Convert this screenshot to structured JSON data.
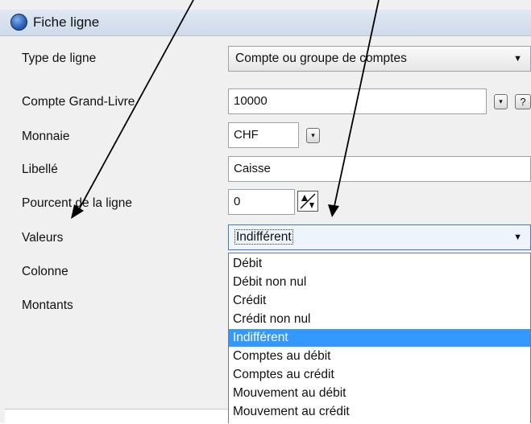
{
  "window": {
    "title": "Fiche ligne",
    "icon": "app-icon"
  },
  "form": {
    "type_ligne": {
      "label": "Type de ligne",
      "value": "Compte ou groupe de comptes"
    },
    "compte": {
      "label": "Compte Grand-Livre",
      "value": "10000",
      "help_label": "?"
    },
    "monnaie": {
      "label": "Monnaie",
      "value": "CHF"
    },
    "libelle": {
      "label": "Libellé",
      "value": "Caisse"
    },
    "pourcent": {
      "label": "Pourcent de la ligne",
      "value": "0"
    },
    "valeurs": {
      "label": "Valeurs",
      "value": "Indifférent"
    },
    "colonne": {
      "label": "Colonne"
    },
    "montants": {
      "label": "Montants"
    }
  },
  "dropdown": {
    "options": [
      "Débit",
      "Débit non nul",
      "Crédit",
      "Crédit non nul",
      "Indifférent",
      "Comptes au débit",
      "Comptes au crédit",
      "Mouvement au débit",
      "Mouvement au crédit"
    ],
    "selected_index": 4
  },
  "colors": {
    "selection": "#3399ff",
    "titlebar": "#dfe8f3",
    "annotation_arrow": "#000000"
  }
}
